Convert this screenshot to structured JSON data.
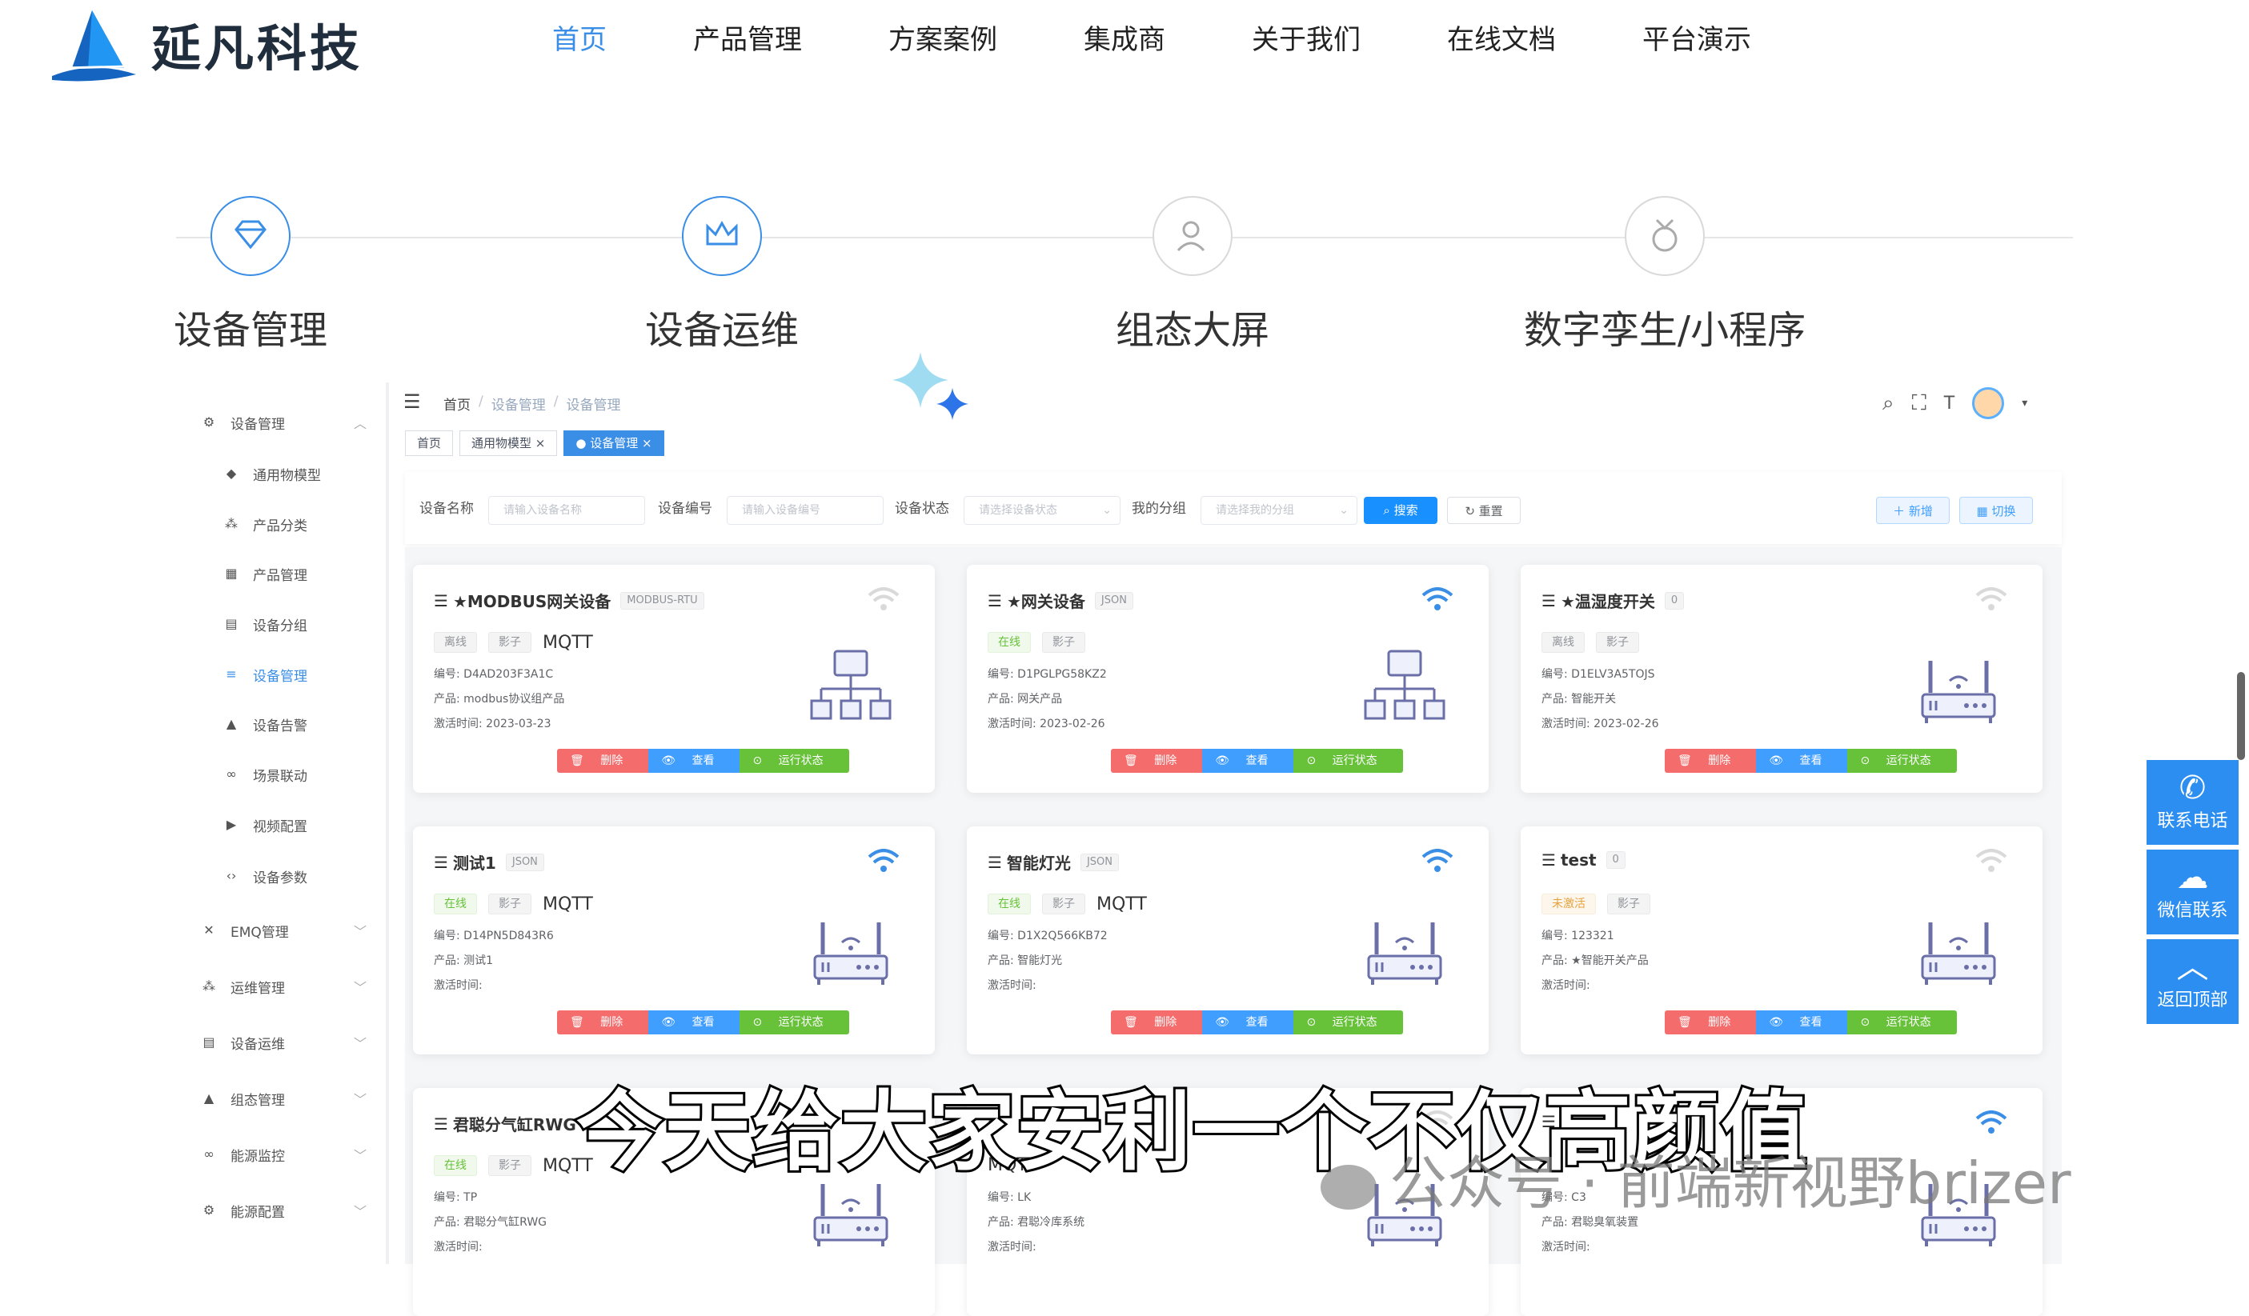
{
  "brand": {
    "name": "延凡科技"
  },
  "nav": {
    "items": [
      "首页",
      "产品管理",
      "方案案例",
      "集成商",
      "关于我们",
      "在线文档",
      "平台演示"
    ],
    "active": "首页"
  },
  "features": [
    {
      "label": "设备管理",
      "icon": "diamond-icon"
    },
    {
      "label": "设备运维",
      "icon": "crown-icon"
    },
    {
      "label": "组态大屏",
      "icon": "user-icon"
    },
    {
      "label": "数字孪生/小程序",
      "icon": "medal-icon"
    }
  ],
  "sidebar": {
    "items": [
      {
        "label": "设备管理",
        "icon": "gear-icon",
        "level": "top",
        "expanded": true
      },
      {
        "label": "通用物模型",
        "icon": "cube-icon",
        "level": "sub"
      },
      {
        "label": "产品分类",
        "icon": "tree-icon",
        "level": "sub"
      },
      {
        "label": "产品管理",
        "icon": "grid-icon",
        "level": "sub"
      },
      {
        "label": "设备分组",
        "icon": "table-icon",
        "level": "sub"
      },
      {
        "label": "设备管理",
        "icon": "list-icon",
        "level": "sub",
        "active": true
      },
      {
        "label": "设备告警",
        "icon": "bell-icon",
        "level": "sub"
      },
      {
        "label": "场景联动",
        "icon": "link-icon",
        "level": "sub"
      },
      {
        "label": "视频配置",
        "icon": "video-icon",
        "level": "sub"
      },
      {
        "label": "设备参数",
        "icon": "code-icon",
        "level": "sub"
      },
      {
        "label": "EMQ管理",
        "icon": "close-icon",
        "level": "top"
      },
      {
        "label": "运维管理",
        "icon": "tree-icon",
        "level": "top"
      },
      {
        "label": "设备运维",
        "icon": "table-icon",
        "level": "top"
      },
      {
        "label": "组态管理",
        "icon": "bell-icon",
        "level": "top"
      },
      {
        "label": "能源监控",
        "icon": "link-icon",
        "level": "top"
      },
      {
        "label": "能源配置",
        "icon": "gear-icon",
        "level": "top"
      }
    ]
  },
  "breadcrumb": [
    "首页",
    "设备管理",
    "设备管理"
  ],
  "tabs": [
    {
      "label": "首页"
    },
    {
      "label": "通用物模型"
    },
    {
      "label": "设备管理",
      "active": true
    }
  ],
  "filter": {
    "name_label": "设备名称",
    "name_ph": "请输入设备名称",
    "code_label": "设备编号",
    "code_ph": "请输入设备编号",
    "status_label": "设备状态",
    "status_ph": "请选择设备状态",
    "group_label": "我的分组",
    "group_ph": "请选择我的分组",
    "search": "搜索",
    "reset": "重置",
    "add": "新增",
    "switch": "切换"
  },
  "card_labels": {
    "code": "编号:",
    "product": "产品:",
    "time": "激活时间:",
    "delete": "删除",
    "view": "查看",
    "status": "运行状态",
    "shadow": "影子"
  },
  "devices": [
    {
      "name": "★MODBUS网关设备",
      "tag": "MODBUS-RTU",
      "status": "离线",
      "status_type": "off",
      "proto": "MQTT",
      "code": "D4AD203F3A1C",
      "product": "modbus协议组产品",
      "time": "2023-03-23",
      "ill": "network",
      "wifi": false
    },
    {
      "name": "★网关设备",
      "tag": "JSON",
      "status": "在线",
      "status_type": "on",
      "proto": "",
      "code": "D1PGLPG58KZ2",
      "product": "网关产品",
      "time": "2023-02-26",
      "ill": "network",
      "wifi": true
    },
    {
      "name": "★温湿度开关",
      "tag": "0",
      "status": "离线",
      "status_type": "off",
      "proto": "",
      "code": "D1ELV3A5TOJS",
      "product": "智能开关",
      "time": "2023-02-26",
      "ill": "router",
      "wifi": false
    },
    {
      "name": "测试1",
      "tag": "JSON",
      "status": "在线",
      "status_type": "on",
      "proto": "MQTT",
      "code": "D14PN5D843R6",
      "product": "测试1",
      "time": "",
      "ill": "router",
      "wifi": true
    },
    {
      "name": "智能灯光",
      "tag": "JSON",
      "status": "在线",
      "status_type": "on",
      "proto": "MQTT",
      "code": "D1X2Q566KB72",
      "product": "智能灯光",
      "time": "",
      "ill": "router",
      "wifi": true
    },
    {
      "name": "test",
      "tag": "0",
      "status": "未激活",
      "status_type": "warn",
      "proto": "",
      "code": "123321",
      "product": "★智能开关产品",
      "time": "",
      "ill": "router",
      "wifi": false
    },
    {
      "name": "君聪分气缸RWG",
      "tag": "",
      "status": "在线",
      "status_type": "on",
      "proto": "MQTT",
      "code": "TP",
      "product": "君聪分气缸RWG",
      "time": "",
      "ill": "router",
      "wifi": false
    },
    {
      "name": "",
      "tag": "",
      "status": "",
      "status_type": "on",
      "proto": "MQTT",
      "code": "LK",
      "product": "君聪冷库系统",
      "time": "",
      "ill": "router",
      "wifi": false
    },
    {
      "name": "",
      "tag": "",
      "status": "",
      "status_type": "on",
      "proto": "",
      "code": "C3",
      "product": "君聪臭氧装置",
      "time": "",
      "ill": "router",
      "wifi": true
    }
  ],
  "float": [
    {
      "label": "联系电话",
      "icon": "phone-icon"
    },
    {
      "label": "微信联系",
      "icon": "wechat-icon"
    },
    {
      "label": "返回顶部",
      "icon": "arrow-up-icon"
    }
  ],
  "subtitle": "今天给大家安利一个不仅高颜值",
  "watermark": "公众号 · 前端新视野brizer",
  "colors": {
    "primary": "#3a8ee6",
    "danger": "#f56c6c",
    "success": "#67c23a",
    "float": "#2b8ef0"
  }
}
